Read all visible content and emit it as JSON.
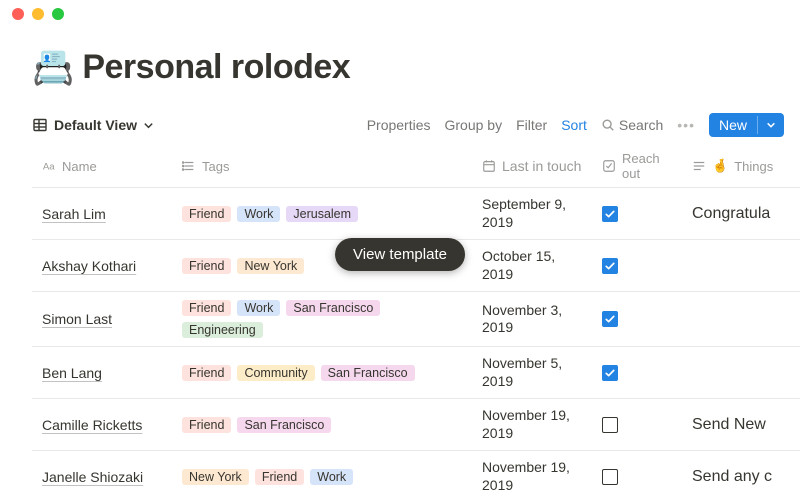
{
  "page": {
    "icon": "📇",
    "title": "Personal rolodex"
  },
  "toolbar": {
    "view_label": "Default View",
    "properties": "Properties",
    "group_by": "Group by",
    "filter": "Filter",
    "sort": "Sort",
    "search": "Search",
    "new": "New"
  },
  "columns": {
    "name": "Name",
    "tags": "Tags",
    "last_in_touch": "Last in touch",
    "reach_out": "Reach out",
    "things": "Things",
    "things_emoji": "🤞"
  },
  "tag_colors": {
    "Friend": "#fde2dd",
    "Work": "#d6e4fa",
    "Jerusalem": "#e6d8f7",
    "New York": "#fde9d1",
    "San Francisco": "#f5d8ee",
    "Engineering": "#dbeddb",
    "Community": "#fdecc8"
  },
  "rows": [
    {
      "name": "Sarah Lim",
      "tags": [
        "Friend",
        "Work",
        "Jerusalem"
      ],
      "date": [
        "September 9,",
        "2019"
      ],
      "checked": true,
      "things": "Congratula"
    },
    {
      "name": "Akshay Kothari",
      "tags": [
        "Friend",
        "New York"
      ],
      "date": [
        "October 15, 2019"
      ],
      "checked": true,
      "things": ""
    },
    {
      "name": "Simon Last",
      "tags": [
        "Friend",
        "Work",
        "San Francisco",
        "Engineering"
      ],
      "date": [
        "November 3,",
        "2019"
      ],
      "checked": true,
      "things": ""
    },
    {
      "name": "Ben Lang",
      "tags": [
        "Friend",
        "Community",
        "San Francisco"
      ],
      "date": [
        "November 5,",
        "2019"
      ],
      "checked": true,
      "things": ""
    },
    {
      "name": "Camille Ricketts",
      "tags": [
        "Friend",
        "San Francisco"
      ],
      "date": [
        "November 19,",
        "2019"
      ],
      "checked": false,
      "things": "Send New"
    },
    {
      "name": "Janelle Shiozaki",
      "tags": [
        "New York",
        "Friend",
        "Work"
      ],
      "date": [
        "November 19,",
        "2019"
      ],
      "checked": false,
      "things": "Send any c"
    }
  ],
  "overlay": {
    "view_template": "View template"
  }
}
